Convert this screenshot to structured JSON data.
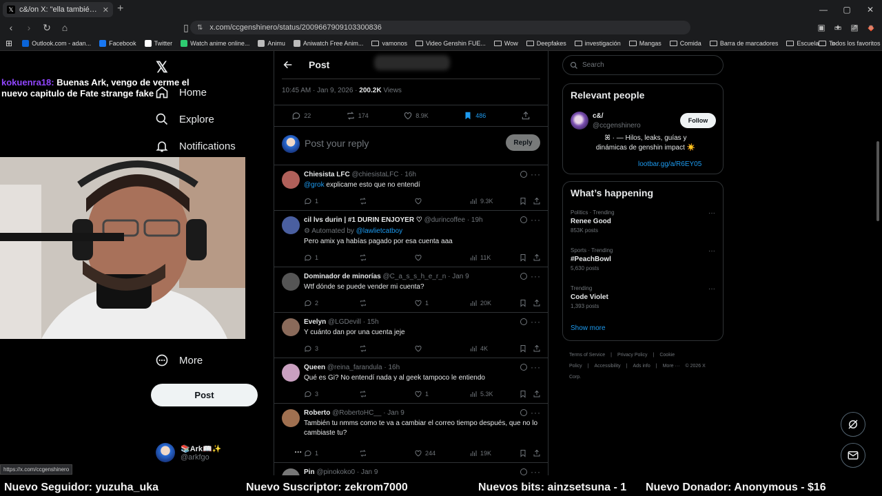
{
  "browser": {
    "tab_title": "c&/on X: \"ella también para que",
    "url": "x.com/ccgenshinero/status/2009667909103300836",
    "new_tab": "+",
    "bookmarks": [
      {
        "label": "Outlook.com - adan...",
        "color": "#0a64d8"
      },
      {
        "label": "Facebook",
        "color": "#1877f2"
      },
      {
        "label": "Twitter",
        "color": "#ffffff"
      },
      {
        "label": "Watch anime online...",
        "color": "#2ecc71"
      },
      {
        "label": "Animu",
        "color": "#bbbbbb"
      },
      {
        "label": "Aniwatch Free Anim...",
        "color": "#bbbbbb"
      },
      {
        "label": "vamonos",
        "folder": true
      },
      {
        "label": "Video Genshin FUE...",
        "folder": true
      },
      {
        "label": "Wow",
        "folder": true
      },
      {
        "label": "Deepfakes",
        "folder": true
      },
      {
        "label": "investigación",
        "folder": true
      },
      {
        "label": "Mangas",
        "folder": true
      },
      {
        "label": "Comida",
        "folder": true
      },
      {
        "label": "Barra de marcadores",
        "folder": true
      },
      {
        "label": "Escuela",
        "folder": true
      }
    ],
    "overflow": "»",
    "all_favorites": "Todos los favoritos",
    "status_url": "https://x.com/ccgenshinero"
  },
  "nav": {
    "home": "Home",
    "explore": "Explore",
    "notifications": "Notifications",
    "more": "More",
    "post_button": "Post"
  },
  "profile": {
    "name": "📚Ark📖✨",
    "handle": "@arkfgo",
    "dots": "···"
  },
  "chat": {
    "user": "kokuenra18:",
    "message": "Buenas Ark, vengo de verme el nuevo capitulo de Fate strange fake"
  },
  "post": {
    "header": "Post",
    "time": "10:45 AM · Jan 9, 2026 ·",
    "views": "200.2K",
    "views_label": "Views",
    "stats": {
      "replies": "22",
      "reposts": "174",
      "likes": "8.9K",
      "bookmarks": "486"
    },
    "reply_placeholder": "Post your reply",
    "reply_button": "Reply"
  },
  "replies": [
    {
      "name": "Chiesista LFC",
      "handle": "@chiesistaLFC · 16h",
      "mention": "@grok",
      "text": " explicame esto que no entendí",
      "r": "1",
      "rt": "",
      "l": "",
      "v": "9.3K",
      "color": "#b0605a"
    },
    {
      "name": "cil lvs durin | #1 DURIN ENJOYER ♡",
      "handle": "@durincoffee · 19h",
      "automated": "Automated by",
      "automated_link": "@lawlietcatboy",
      "text": "Pero amix ya habías pagado por esa cuenta aaa",
      "r": "1",
      "rt": "",
      "l": "",
      "v": "11K",
      "color": "#4a5fa0"
    },
    {
      "name": "Dominador de minorías",
      "handle": "@C_a_s_s_h_e_r_n · Jan 9",
      "text": "Wtf dónde se puede vender mi cuenta?",
      "r": "2",
      "rt": "",
      "l": "1",
      "v": "20K",
      "color": "#555555"
    },
    {
      "name": "Evelyn",
      "handle": "@LGDevill · 15h",
      "text": "Y cuánto dan por una cuenta jeje",
      "r": "3",
      "rt": "",
      "l": "",
      "v": "4K",
      "color": "#8a6a5a"
    },
    {
      "name": "Queen",
      "handle": "@reina_farandula · 16h",
      "text": "Qué es Gi? No entendí nada y al geek tampoco le entiendo",
      "r": "3",
      "rt": "",
      "l": "1",
      "v": "5.3K",
      "color": "#c9a0c0"
    },
    {
      "name": "Roberto",
      "handle": "@RobertoHC__ · Jan 9",
      "text": "También tu nmms como te va a cambiar el correo tiempo después, que no lo cambiaste tu?",
      "r": "1",
      "rt": "",
      "l": "244",
      "v": "19K",
      "color": "#a07050"
    },
    {
      "name": "Pin",
      "handle": "@pinokoko0 · Jan 9",
      "text": "",
      "color": "#777777"
    }
  ],
  "sidebar": {
    "search_placeholder": "Search",
    "relevant_title": "Relevant people",
    "person_name": "c&/",
    "person_handle": "@ccgenshinero",
    "follow": "Follow",
    "bio": "ꕤ · — Hilos, leaks, guías y dinámicas de genshin impact ☀️",
    "bio_link": "lootbar.gg/a/R6EY05",
    "happening_title": "What’s happening",
    "trends": [
      {
        "category": "Politics · Trending",
        "name": "Renee Good",
        "count": "853K posts"
      },
      {
        "category": "Sports · Trending",
        "name": "#PeachBowl",
        "count": "5,630 posts"
      },
      {
        "category": "Trending",
        "name": "Code Violet",
        "count": "1,393 posts"
      }
    ],
    "show_more": "Show more",
    "footer": [
      "Terms of Service",
      "|",
      "Privacy Policy",
      "|",
      "Cookie Policy",
      "|",
      "Accessibility",
      "|",
      "Ads info",
      "|",
      "More ···",
      "© 2026 X Corp."
    ]
  },
  "ticker": {
    "follower": "Nuevo Seguidor: yuzuha_uka",
    "subscriber": "Nuevo Suscriptor: zekrom7000",
    "bits": "Nuevos bits: ainzsetsuna - 1",
    "donor": "Nuevo Donador: Anonymous - $16"
  },
  "colors": {
    "accent": "#1d9bf0",
    "bookmark_active": "#1d9bf0",
    "chat_user": "#9146ff"
  }
}
